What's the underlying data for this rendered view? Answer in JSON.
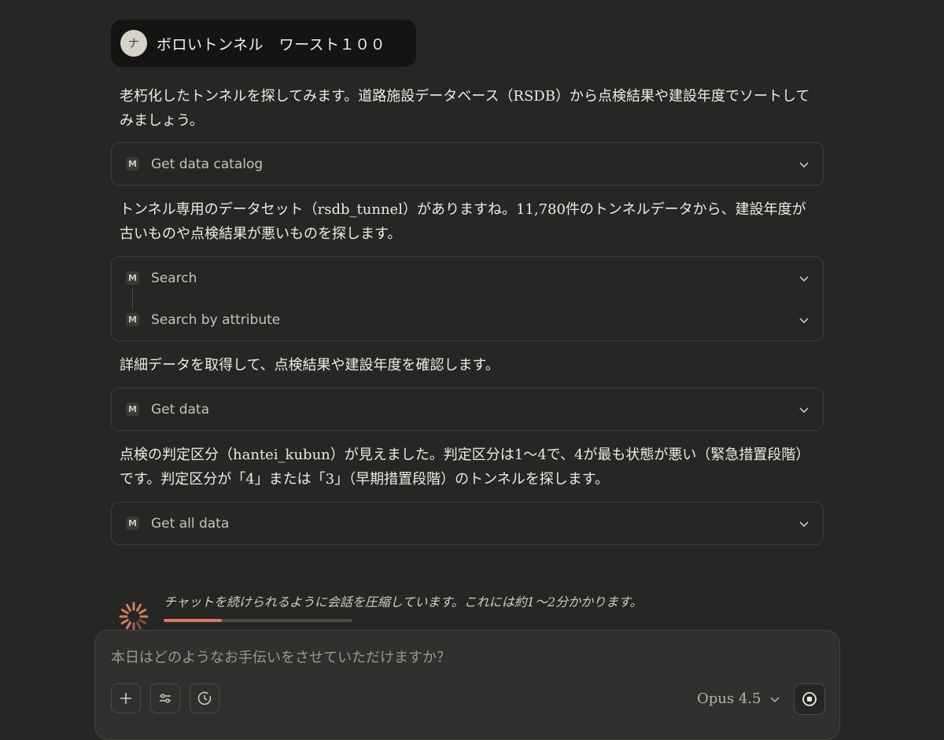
{
  "user_message": {
    "avatar_initial": "ナ",
    "text": "ボロいトンネル　ワースト１００"
  },
  "messages": [
    {
      "text": "老朽化したトンネルを探してみます。道路施設データベース（RSDB）から点検結果や建設年度でソートしてみましょう。"
    },
    {
      "text": "トンネル専用のデータセット（rsdb_tunnel）がありますね。11,780件のトンネルデータから、建設年度が古いものや点検結果が悪いものを探します。"
    },
    {
      "text": "詳細データを取得して、点検結果や建設年度を確認します。"
    },
    {
      "text": "点検の判定区分（hantei_kubun）が見えました。判定区分は1〜4で、4が最も状態が悪い（緊急措置段階）です。判定区分が「4」または「3」（早期措置段階）のトンネルを探します。"
    }
  ],
  "tools": [
    {
      "icon": "M",
      "label": "Get data catalog"
    },
    {
      "icon": "M",
      "label": "Search"
    },
    {
      "icon": "M",
      "label": "Search by attribute"
    },
    {
      "icon": "M",
      "label": "Get data"
    },
    {
      "icon": "M",
      "label": "Get all data"
    }
  ],
  "status": {
    "text": "チャットを続けられるように会話を圧縮しています。これには約1〜2分かかります。",
    "progress": 0.31
  },
  "composer": {
    "placeholder": "本日はどのようなお手伝いをさせていただけますか？",
    "model": "Opus 4.5"
  },
  "colors": {
    "background": "#262624",
    "accent": "#d27d62",
    "user_bubble": "#141413"
  }
}
